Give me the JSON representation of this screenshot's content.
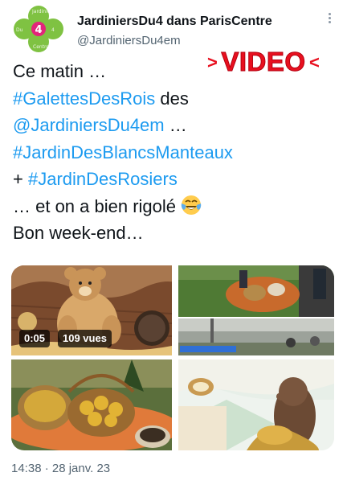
{
  "tweet": {
    "display_name": "JardiniersDu4 dans ParisCentre",
    "handle": "@JardiniersDu4em",
    "avatar_logo_text": "Jardiniers Du 4 Centre",
    "video_banner": {
      "left_arrow": ">",
      "word": "VIDEO",
      "right_arrow": "<"
    },
    "lines": [
      {
        "text": "Ce matin …"
      },
      {
        "tag": "#GalettesDesRois",
        "rest": " des"
      },
      {
        "tag": "@JardiniersDu4em",
        "rest": " …"
      },
      {
        "tag": "#JardinDesBlancsManteaux"
      },
      {
        "prefix": "+ ",
        "tag": "#JardinDesRosiers"
      },
      {
        "text": "… et on a bien rigolé",
        "emoji": "face-with-tears-of-joy"
      },
      {
        "text": "Bon week-end…"
      }
    ],
    "media": {
      "video_duration": "0:05",
      "video_views": "109 vues"
    },
    "timestamp": "14:38 · 28 janv. 23"
  },
  "colors": {
    "link": "#1d9bf0",
    "text": "#0f1419",
    "secondary": "#536471",
    "video_banner": "#e8101f"
  }
}
